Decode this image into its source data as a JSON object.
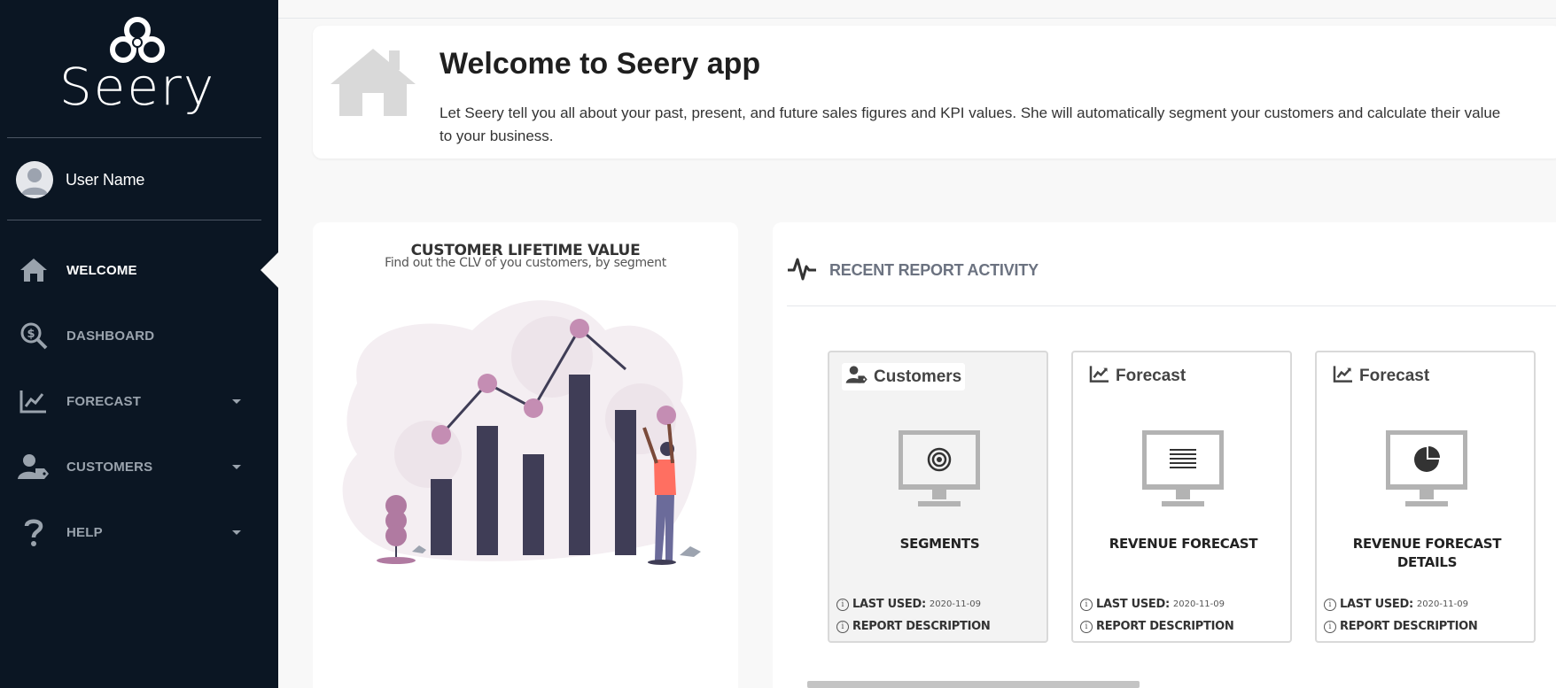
{
  "app": {
    "logo_text": "Seery",
    "brand_color": "#0b1623"
  },
  "user": {
    "name": "User Name"
  },
  "nav": [
    {
      "label": "WELCOME",
      "icon": "home-icon",
      "active": true,
      "has_caret": false
    },
    {
      "label": "DASHBOARD",
      "icon": "dollar-search-icon",
      "active": false,
      "has_caret": false
    },
    {
      "label": "FORECAST",
      "icon": "chart-area-icon",
      "active": false,
      "has_caret": true
    },
    {
      "label": "CUSTOMERS",
      "icon": "user-tag-icon",
      "active": false,
      "has_caret": true
    },
    {
      "label": "HELP",
      "icon": "question-icon",
      "active": false,
      "has_caret": true
    }
  ],
  "welcome": {
    "title": "Welcome to Seery app",
    "text": "Let Seery tell you all about your past, present, and future sales figures and KPI values. She will automatically segment your customers and calculate their value to your business.",
    "icon": "home-icon"
  },
  "clv_card": {
    "title": "CUSTOMER LIFETIME VALUE",
    "subtitle": "Find out the CLV of you customers, by segment",
    "illustration": "growth-chart-illustration"
  },
  "recent": {
    "title": "RECENT REPORT ACTIVITY",
    "icon": "heartbeat-icon",
    "cards": [
      {
        "tag": "Customers",
        "tag_icon": "user-tag-icon",
        "monitor_icon": "target-icon",
        "name": "SEGMENTS",
        "last_used_label": "LAST USED:",
        "last_used": "2020-11-09",
        "description_label": "REPORT DESCRIPTION"
      },
      {
        "tag": "Forecast",
        "tag_icon": "chart-line-icon",
        "monitor_icon": "list-lines-icon",
        "name": "REVENUE FORECAST",
        "last_used_label": "LAST USED:",
        "last_used": "2020-11-09",
        "description_label": "REPORT DESCRIPTION"
      },
      {
        "tag": "Forecast",
        "tag_icon": "chart-line-icon",
        "monitor_icon": "pie-chart-icon",
        "name": "REVENUE FORECAST DETAILS",
        "last_used_label": "LAST USED:",
        "last_used": "2020-11-09",
        "description_label": "REPORT DESCRIPTION"
      }
    ]
  }
}
